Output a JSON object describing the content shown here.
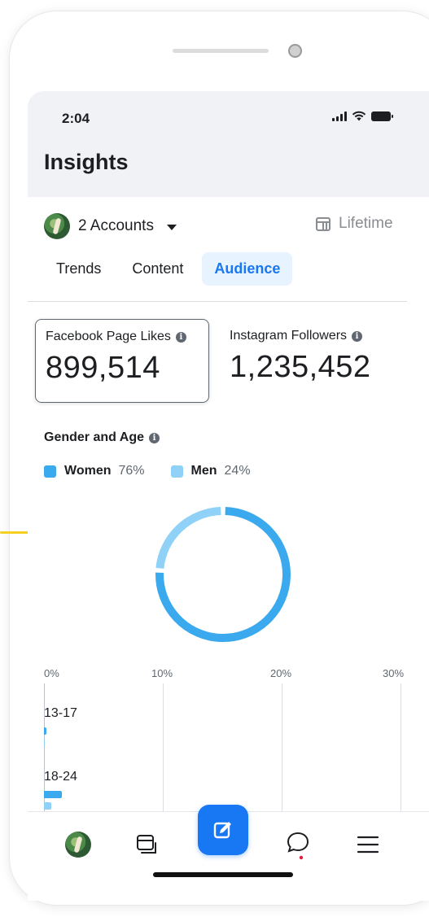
{
  "status_bar": {
    "time": "2:04"
  },
  "header": {
    "title": "Insights"
  },
  "accounts": {
    "label": "2 Accounts"
  },
  "date_range": {
    "label": "Lifetime"
  },
  "tabs": [
    {
      "label": "Trends",
      "active": false
    },
    {
      "label": "Content",
      "active": false
    },
    {
      "label": "Audience",
      "active": true
    }
  ],
  "metrics": {
    "facebook": {
      "label": "Facebook Page Likes",
      "value": "899,514"
    },
    "instagram": {
      "label": "Instagram Followers",
      "value": "1,235,452"
    }
  },
  "gender_age": {
    "title": "Gender and Age",
    "legend": [
      {
        "name": "Women",
        "pct": "76%",
        "color": "#3ba9ee"
      },
      {
        "name": "Men",
        "pct": "24%",
        "color": "#8fd1f7"
      }
    ]
  },
  "chart_data": {
    "type": "bar",
    "axis_ticks": [
      "0%",
      "10%",
      "20%",
      "30%"
    ],
    "xlim": [
      0,
      30
    ],
    "categories": [
      "13-17",
      "18-24"
    ],
    "series": [
      {
        "name": "Women",
        "values": [
          0.2,
          1.5
        ]
      },
      {
        "name": "Men",
        "values": [
          0.1,
          0.6
        ]
      }
    ],
    "donut": {
      "type": "pie",
      "series": [
        {
          "name": "Women",
          "value": 76
        },
        {
          "name": "Men",
          "value": 24
        }
      ]
    }
  },
  "nav": {
    "items": [
      "profile-avatar",
      "pages-icon",
      "compose-icon",
      "messages-icon",
      "menu-icon"
    ]
  }
}
